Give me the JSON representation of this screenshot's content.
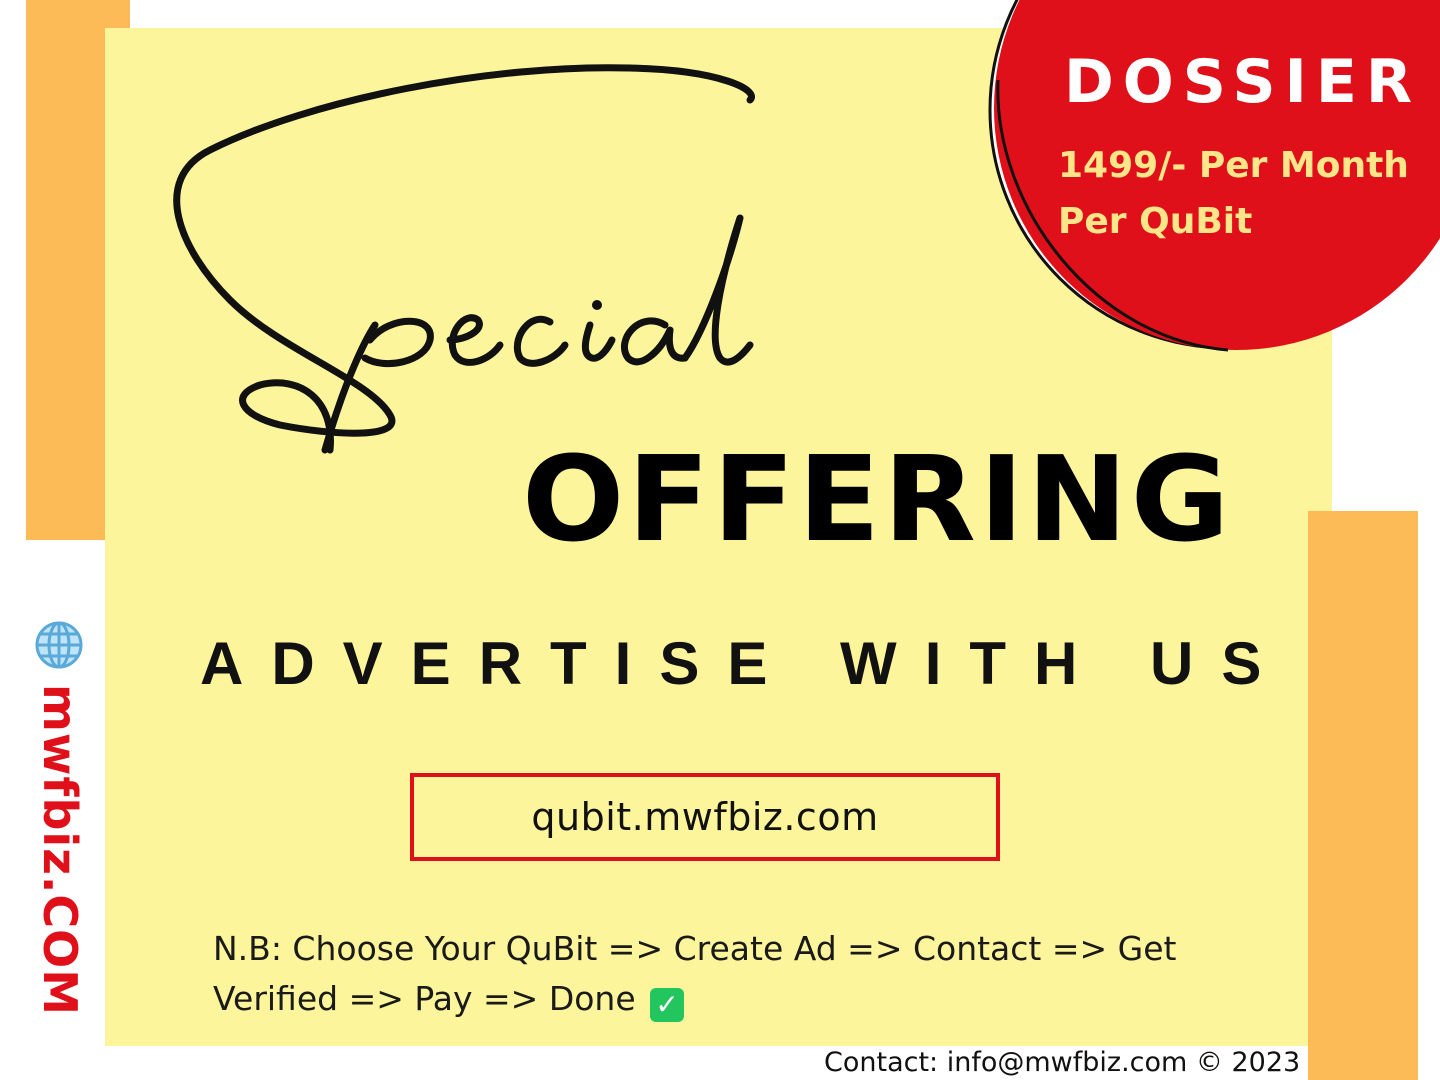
{
  "script_heading": "Special",
  "headline": "OFFERING",
  "tagline": "ADVERTISE WITH US",
  "url": "qubit.mwfbiz.com",
  "note": {
    "line1": "N.B: Choose Your QuBit => Create Ad => Contact => Get",
    "line2": "Verified => Pay => Done"
  },
  "badge": {
    "title": "DOSSIER",
    "price_line1": "1499/- Per Month",
    "price_line2": "Per QuBit"
  },
  "side_brand": "mwfbiz.COM",
  "contact": "Contact: info@mwfbiz.com  © 2023",
  "colors": {
    "yellow": "#fdf59b",
    "orange": "#fdbb58",
    "red": "#e0101a",
    "price_text": "#fde68a"
  },
  "icons": [
    "globe-icon",
    "check-icon"
  ]
}
